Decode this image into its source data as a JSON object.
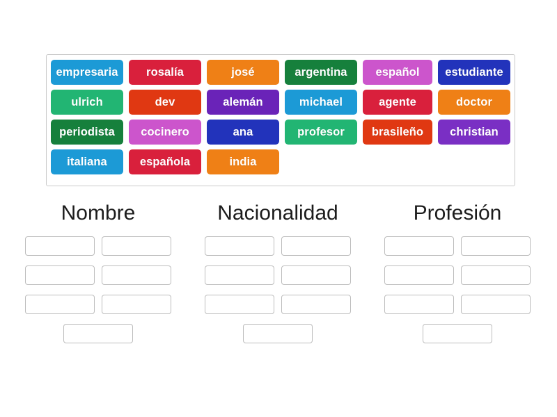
{
  "activity": {
    "type": "group-sort",
    "panel_background": "#ffffff",
    "panel_border": "#c9c9c9"
  },
  "tile_bank": {
    "rows": [
      [
        {
          "label": "empresaria",
          "color": "#1c9ad6"
        },
        {
          "label": "rosalía",
          "color": "#d9203c"
        },
        {
          "label": "josé",
          "color": "#ef8016"
        },
        {
          "label": "argentina",
          "color": "#16803c"
        },
        {
          "label": "español",
          "color": "#cc55cc"
        },
        {
          "label": "estudiante",
          "color": "#2233bb"
        }
      ],
      [
        {
          "label": "ulrich",
          "color": "#22b573"
        },
        {
          "label": "dev",
          "color": "#e03812"
        },
        {
          "label": "alemán",
          "color": "#6a23b8"
        },
        {
          "label": "michael",
          "color": "#1c9ad6"
        },
        {
          "label": "agente",
          "color": "#d9203c"
        },
        {
          "label": "doctor",
          "color": "#ef8016"
        }
      ],
      [
        {
          "label": "periodista",
          "color": "#16803c"
        },
        {
          "label": "cocinero",
          "color": "#cc55cc"
        },
        {
          "label": "ana",
          "color": "#2233bb"
        },
        {
          "label": "profesor",
          "color": "#22b573"
        },
        {
          "label": "brasileño",
          "color": "#e03812"
        },
        {
          "label": "christian",
          "color": "#7a2fc4"
        }
      ],
      [
        {
          "label": "italiana",
          "color": "#1c9ad6"
        },
        {
          "label": "española",
          "color": "#d9203c"
        },
        {
          "label": "india",
          "color": "#ef8016"
        }
      ]
    ]
  },
  "categories": [
    {
      "title": "Nombre",
      "slots": [
        "",
        "",
        "",
        "",
        "",
        "",
        ""
      ]
    },
    {
      "title": "Nacionalidad",
      "slots": [
        "",
        "",
        "",
        "",
        "",
        "",
        ""
      ]
    },
    {
      "title": "Profesión",
      "slots": [
        "",
        "",
        "",
        "",
        "",
        "",
        ""
      ]
    }
  ]
}
